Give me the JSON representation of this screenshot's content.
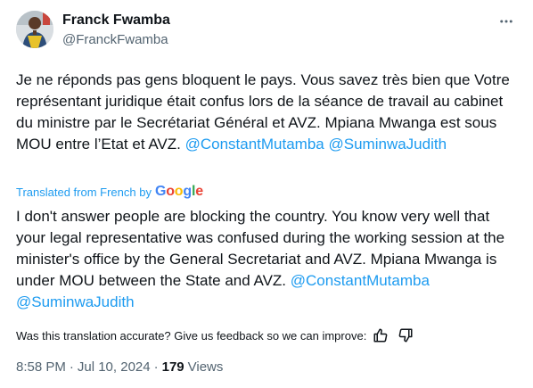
{
  "author": {
    "name": "Franck Fwamba",
    "handle": "@FranckFwamba",
    "avatar_icon": "avatar-photo"
  },
  "original_text": {
    "part1": "Je ne réponds pas gens bloquent le pays. Vous savez très bien que Votre représentant juridique était confus lors de la séance de travail au cabinet du ministre par le Secrétariat Général et AVZ. Mpiana Mwanga est sous MOU entre l’Etat et AVZ.",
    "mention1": "@ConstantMutamba",
    "mention2": "@SuminwaJudith"
  },
  "translation_label": "Translated from French by",
  "google_logo": "Google",
  "translated_text": {
    "part1": "I don't answer people are blocking the country. You know very well that your legal representative was confused during the working session at the minister's office by the General Secretariat and AVZ. Mpiana Mwanga is under MOU between the State and AVZ.",
    "mention1": "@ConstantMutamba",
    "mention2": "@SuminwaJudith"
  },
  "feedback": {
    "prompt": "Was this translation accurate? Give us feedback so we can improve:",
    "thumbs_up_icon": "thumbs-up-icon",
    "thumbs_down_icon": "thumbs-down-icon"
  },
  "meta": {
    "time": "8:58 PM",
    "separator": "·",
    "date": "Jul 10, 2024",
    "views_count": "179",
    "views_label": "Views"
  },
  "colors": {
    "link": "#1d9bf0",
    "text": "#0f1419",
    "secondary": "#536471"
  }
}
